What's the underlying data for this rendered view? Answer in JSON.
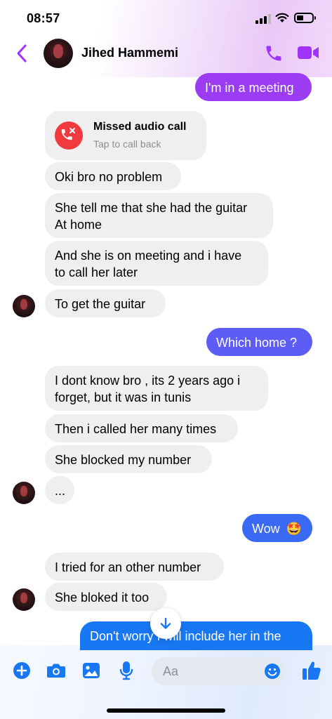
{
  "status": {
    "time": "08:57"
  },
  "header": {
    "name": "Jihed Hammemi"
  },
  "colors": {
    "accent": "#a033ff",
    "outgoing_top": "#9b3cf3",
    "outgoing_mid": "#5d5cf6",
    "outgoing_bottom": "#1877f2",
    "missed_call": "#f03a3e"
  },
  "icons": [
    "back-chevron-icon",
    "phone-icon",
    "video-camera-icon",
    "missed-call-icon",
    "plus-icon",
    "camera-icon",
    "gallery-icon",
    "microphone-icon",
    "emoji-icon",
    "thumbs-up-icon",
    "arrow-down-icon"
  ],
  "missed_call": {
    "title": "Missed audio call",
    "subtitle": "Tap to call back"
  },
  "messages": {
    "m1": "I'm in a meeting",
    "m2": "Oki bro no problem",
    "m3a": "She tell me that she had the guitar",
    "m3b": "At home",
    "m4a": "And she is on meeting and i have",
    "m4b": "to call her later",
    "m5": "To get the guitar",
    "m6": "Which home ?",
    "m7a": "I dont know bro , its 2 years ago i",
    "m7b": "forget, but it was in tunis",
    "m8": "Then i called her many times",
    "m9": "She blocked my number",
    "m10": "...",
    "m11": "Wow",
    "m11_emoji": "🤩",
    "m12": "I tried for an other number",
    "m13": "She bloked it too",
    "m14": "Don't worry I will include her in the"
  },
  "composer": {
    "placeholder": "Aa"
  }
}
